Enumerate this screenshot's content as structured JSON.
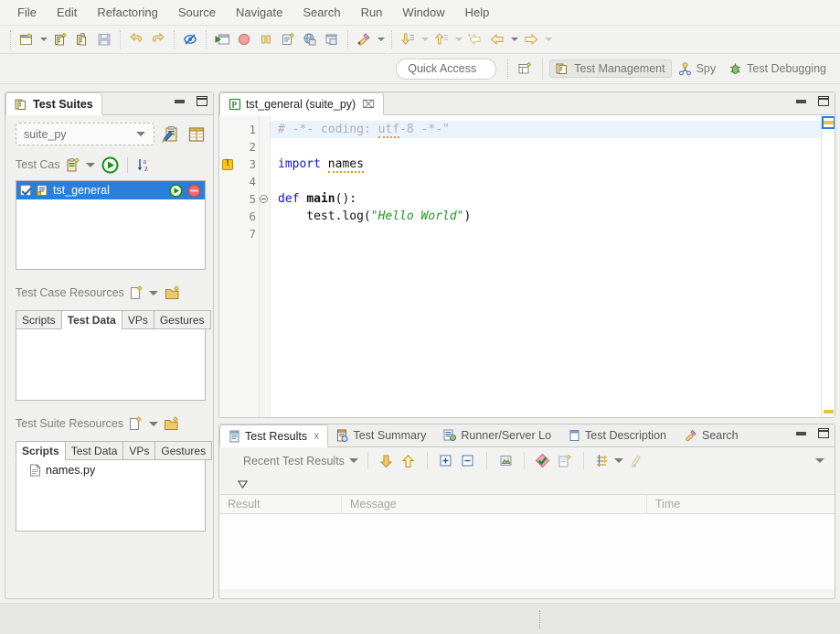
{
  "menubar": {
    "items": [
      {
        "label": "File"
      },
      {
        "label": "Edit"
      },
      {
        "label": "Refactoring"
      },
      {
        "label": "Source"
      },
      {
        "label": "Navigate"
      },
      {
        "label": "Search"
      },
      {
        "label": "Run"
      },
      {
        "label": "Window"
      },
      {
        "label": "Help"
      }
    ]
  },
  "toolbar": {
    "groups": [
      {
        "buttons": [
          {
            "icon": "new-file-icon",
            "name": "new"
          },
          {
            "icon": "dropdown-arrow-icon",
            "name": "new-dropdown",
            "type": "arrow"
          },
          {
            "icon": "new-test-suite-icon",
            "name": "new-test-suite"
          },
          {
            "icon": "new-test-case-icon",
            "name": "new-test-case"
          },
          {
            "icon": "save-icon",
            "name": "save"
          }
        ]
      },
      {
        "buttons": [
          {
            "icon": "undo-icon",
            "name": "undo"
          },
          {
            "icon": "redo-icon",
            "name": "redo"
          }
        ]
      },
      {
        "buttons": [
          {
            "icon": "hide-annotations-icon",
            "name": "toggle-annotations"
          }
        ]
      },
      {
        "buttons": [
          {
            "icon": "run-application-icon",
            "name": "run-application"
          },
          {
            "icon": "record-icon",
            "name": "record"
          },
          {
            "icon": "pause-icon",
            "name": "pause"
          },
          {
            "icon": "new-script-icon",
            "name": "new-script"
          },
          {
            "icon": "globe-save-icon",
            "name": "web-save"
          },
          {
            "icon": "window-restore-icon",
            "name": "restore-window"
          }
        ]
      },
      {
        "buttons": [
          {
            "icon": "run-icon",
            "name": "run"
          },
          {
            "icon": "dropdown-arrow-icon",
            "name": "run-dropdown",
            "type": "arrow"
          }
        ]
      },
      {
        "buttons": [
          {
            "icon": "step-into-icon",
            "name": "step-into"
          },
          {
            "icon": "dropdown-arrow-icon",
            "name": "step-into-dropdown",
            "type": "arrow",
            "dim": true
          },
          {
            "icon": "step-out-icon",
            "name": "step-out"
          },
          {
            "icon": "dropdown-arrow-icon",
            "name": "step-out-dropdown",
            "type": "arrow",
            "dim": true
          },
          {
            "icon": "back-to-icon",
            "name": "back-to"
          },
          {
            "icon": "back-icon",
            "name": "navigate-back"
          },
          {
            "icon": "dropdown-arrow-icon",
            "name": "back-dropdown",
            "type": "arrow"
          },
          {
            "icon": "forward-icon",
            "name": "navigate-forward"
          },
          {
            "icon": "dropdown-arrow-icon",
            "name": "forward-dropdown",
            "type": "arrow",
            "dim": true
          }
        ]
      }
    ]
  },
  "perspective_bar": {
    "quick_access_placeholder": "Quick Access",
    "open_perspective_tooltip": "Open Perspective",
    "items": [
      {
        "label": "Test Management",
        "icon": "test-management-icon",
        "active": true
      },
      {
        "label": "Spy",
        "icon": "spy-icon",
        "active": false
      },
      {
        "label": "Test Debugging",
        "icon": "test-debugging-icon",
        "active": false
      }
    ]
  },
  "test_suites": {
    "tab_label": "Test Suites",
    "tab_icon": "test-suites-icon",
    "suite_combo_value": "suite_py",
    "toolbar_icons": [
      "edit-suite-icon",
      "suite-table-icon"
    ],
    "test_case_section": {
      "title": "Test Cas",
      "icons": [
        "new-test-case-icon",
        "dropdown-arrow-icon",
        "run-test-icon",
        "sort-az-icon"
      ],
      "rows": [
        {
          "label": "tst_general",
          "checked": true,
          "selected": true,
          "icon": "test-case-icon",
          "actions": [
            "run-icon",
            "stop-icon"
          ]
        }
      ]
    },
    "test_case_resources": {
      "title": "Test Case Resources",
      "icons": [
        "new-resource-icon",
        "dropdown-arrow-icon",
        "new-folder-icon"
      ],
      "tabs": [
        {
          "label": "Scripts",
          "active": false
        },
        {
          "label": "Test Data",
          "active": true
        },
        {
          "label": "VPs",
          "active": false
        },
        {
          "label": "Gestures",
          "active": false
        }
      ],
      "items": []
    },
    "test_suite_resources": {
      "title": "Test Suite Resources",
      "icons": [
        "new-resource-icon",
        "dropdown-arrow-icon",
        "new-folder-icon"
      ],
      "tabs": [
        {
          "label": "Scripts",
          "active": true
        },
        {
          "label": "Test Data",
          "active": false
        },
        {
          "label": "VPs",
          "active": false
        },
        {
          "label": "Gestures",
          "active": false
        }
      ],
      "items": [
        {
          "label": "names.py",
          "icon": "python-file-icon"
        }
      ]
    }
  },
  "editor": {
    "tab_label": "tst_general (suite_py)",
    "tab_icon": "python-editor-icon",
    "close_glyph": "⌧",
    "lines": [
      {
        "number": "1",
        "highlighted": true,
        "warning": false,
        "fold": false,
        "tokens": [
          {
            "t": "# -*- coding: ",
            "c": "com"
          },
          {
            "t": "utf",
            "c": "com squig"
          },
          {
            "t": "-8 -*-\"",
            "c": "com"
          }
        ]
      },
      {
        "number": "2",
        "highlighted": false,
        "warning": false,
        "fold": false,
        "tokens": []
      },
      {
        "number": "3",
        "highlighted": false,
        "warning": true,
        "fold": false,
        "tokens": [
          {
            "t": "import",
            "c": "kw"
          },
          {
            "t": " ",
            "c": "plain"
          },
          {
            "t": "names",
            "c": "plain squig"
          }
        ]
      },
      {
        "number": "4",
        "highlighted": false,
        "warning": false,
        "fold": false,
        "tokens": []
      },
      {
        "number": "5",
        "highlighted": false,
        "warning": false,
        "fold": true,
        "tokens": [
          {
            "t": "def",
            "c": "kw"
          },
          {
            "t": " ",
            "c": "plain"
          },
          {
            "t": "main",
            "c": "fn"
          },
          {
            "t": "():",
            "c": "plain"
          }
        ]
      },
      {
        "number": "6",
        "highlighted": false,
        "warning": false,
        "fold": false,
        "tokens": [
          {
            "t": "    test.log(",
            "c": "plain"
          },
          {
            "t": "\"Hello World\"",
            "c": "str"
          },
          {
            "t": ")",
            "c": "plain"
          }
        ]
      },
      {
        "number": "7",
        "highlighted": false,
        "warning": false,
        "fold": false,
        "tokens": []
      }
    ]
  },
  "results_panel": {
    "tabs": [
      {
        "label": "Test Results",
        "icon": "test-results-icon",
        "active": true
      },
      {
        "label": "Test Summary",
        "icon": "test-summary-icon",
        "active": false
      },
      {
        "label": "Runner/Server Lo",
        "icon": "runner-log-icon",
        "active": false
      },
      {
        "label": "Test Description",
        "icon": "test-description-icon",
        "active": false
      },
      {
        "label": "Search",
        "icon": "search-icon",
        "active": false
      }
    ],
    "toolbar": {
      "dropdown_label": "Recent Test Results",
      "buttons": [
        {
          "name": "next-failure",
          "icon": "down-arrow-icon"
        },
        {
          "name": "previous-failure",
          "icon": "up-arrow-icon"
        },
        {
          "name": "expand-all",
          "icon": "expand-all-icon"
        },
        {
          "name": "collapse-all",
          "icon": "collapse-all-icon"
        },
        {
          "name": "show-screenshot",
          "icon": "screenshot-icon"
        },
        {
          "name": "show-passed",
          "icon": "pass-filter-icon"
        },
        {
          "name": "new-report",
          "icon": "new-report-icon"
        },
        {
          "name": "compare-results",
          "icon": "compare-icon"
        },
        {
          "name": "compare-dropdown",
          "icon": "dropdown-arrow-icon"
        },
        {
          "name": "highlight",
          "icon": "highlight-icon"
        },
        {
          "name": "view-menu",
          "icon": "dropdown-arrow-icon"
        }
      ]
    },
    "table": {
      "columns": [
        "Result",
        "Message",
        "Time"
      ],
      "rows": []
    }
  },
  "colors": {
    "selection_blue": "#2a7fdd",
    "line_highlight": "#eaf2fd",
    "keyword_blue": "#1414cf",
    "string_green": "#1d9b1d",
    "comment_gray": "#b0b0b0",
    "warning_yellow": "#f3c620",
    "chrome_gray": "#f0f0ee"
  }
}
